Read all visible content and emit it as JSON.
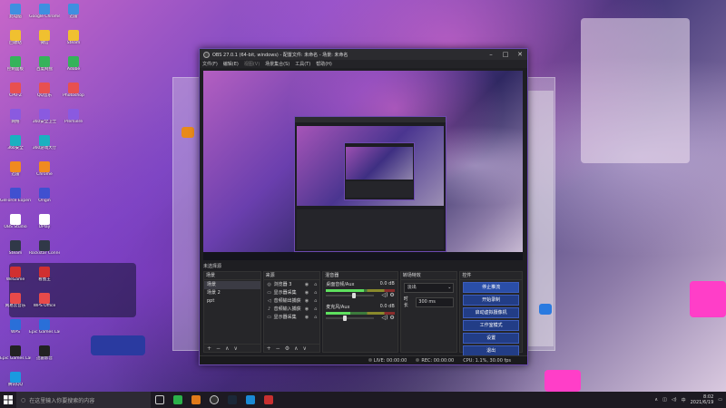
{
  "desktop": {
    "icons_col1": [
      "此电脑",
      "回收站",
      "控制面板",
      "CPU-Z",
      "网络",
      "360安全",
      "迅雷",
      "GeForce Experience",
      "OBS Studio",
      "Steam",
      "WeGame",
      "网易云音乐",
      "WPS",
      "Epic Games Launcher",
      "腾讯QQ"
    ],
    "icons_col2": [
      "Google Chrome",
      "微信",
      "百度网盘",
      "QQ音乐",
      "360安全卫士",
      "360游戏大厅",
      "Chrome",
      "Origin",
      "UPlay",
      "Rockstar Connect",
      "看图王",
      "WPS Office",
      "Epic Games Launcher",
      "迅雷影音"
    ],
    "icons_col3": [
      "迅雷",
      "Steam",
      "Adobe",
      "Photoshop",
      "Premiere"
    ]
  },
  "obs": {
    "title": "OBS 27.0.1 (64-bit, windows) - 配置文件: 未命名 - 场景: 未命名",
    "menu": [
      "文件(F)",
      "编辑(E)",
      "视图(V)",
      "场景集合(S)",
      "工具(T)",
      "帮助(H)"
    ],
    "menu_dim_index": 2,
    "scene_label": "未选择源",
    "docks": {
      "scenes_title": "场景",
      "scenes": [
        "场景",
        "场景 2",
        "ppt"
      ],
      "sources_title": "来源",
      "sources": [
        {
          "name": "浏览器 3",
          "icon": "browser-icon"
        },
        {
          "name": "显示器采集",
          "icon": "monitor-icon"
        },
        {
          "name": "音频输出捕获",
          "icon": "speaker-icon"
        },
        {
          "name": "音频输入捕获",
          "icon": "mic-icon"
        },
        {
          "name": "显示器采集",
          "icon": "monitor-icon"
        }
      ],
      "mixer_title": "混音器",
      "mixer": [
        {
          "name": "桌面音频/Aux",
          "db": "0.0 dB",
          "level": 0.55
        },
        {
          "name": "麦克风/Aux",
          "db": "0.0 dB",
          "level": 0.35
        }
      ],
      "transitions_title": "转场特效",
      "transition_type": "淡出",
      "duration_label": "时长",
      "duration_value": "300 ms",
      "controls_title": "控件",
      "controls": [
        "停止推流",
        "开始录制",
        "启动虚拟摄像机",
        "工作室模式",
        "设置",
        "退出"
      ]
    },
    "status": {
      "live": "LIVE: 00:00:00",
      "rec": "REC: 00:00:00",
      "cpu": "CPU: 1.1%, 30.00 fps"
    }
  },
  "taskbar": {
    "search_placeholder": "在这里输入你要搜索的内容",
    "time": "8:02",
    "date": "2021/6/19",
    "lang": "中"
  },
  "colors": {
    "accent": "#6d4ab0",
    "control_button": "#223d86",
    "wallpaper_pink": "#e040c8"
  }
}
